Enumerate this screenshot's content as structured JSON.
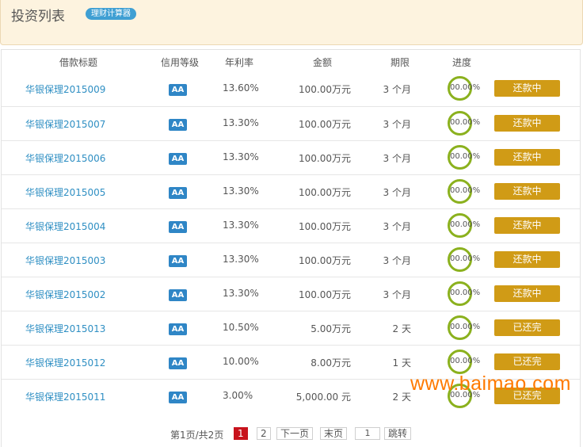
{
  "header": {
    "title": "投资列表",
    "calc_label": "理财计算器"
  },
  "columns": [
    "借款标题",
    "信用等级",
    "年利率",
    "金额",
    "期限",
    "进度"
  ],
  "rows": [
    {
      "title": "华银保理2015009",
      "grade": "AA",
      "rate": "13.60%",
      "amount": "100.00万元",
      "term": "3 个月",
      "progress": "00.00%",
      "status": "还款中"
    },
    {
      "title": "华银保理2015007",
      "grade": "AA",
      "rate": "13.30%",
      "amount": "100.00万元",
      "term": "3 个月",
      "progress": "00.00%",
      "status": "还款中"
    },
    {
      "title": "华银保理2015006",
      "grade": "AA",
      "rate": "13.30%",
      "amount": "100.00万元",
      "term": "3 个月",
      "progress": "00.00%",
      "status": "还款中"
    },
    {
      "title": "华银保理2015005",
      "grade": "AA",
      "rate": "13.30%",
      "amount": "100.00万元",
      "term": "3 个月",
      "progress": "00.00%",
      "status": "还款中"
    },
    {
      "title": "华银保理2015004",
      "grade": "AA",
      "rate": "13.30%",
      "amount": "100.00万元",
      "term": "3 个月",
      "progress": "00.00%",
      "status": "还款中"
    },
    {
      "title": "华银保理2015003",
      "grade": "AA",
      "rate": "13.30%",
      "amount": "100.00万元",
      "term": "3 个月",
      "progress": "00.00%",
      "status": "还款中"
    },
    {
      "title": "华银保理2015002",
      "grade": "AA",
      "rate": "13.30%",
      "amount": "100.00万元",
      "term": "3 个月",
      "progress": "00.00%",
      "status": "还款中"
    },
    {
      "title": "华银保理2015013",
      "grade": "AA",
      "rate": "10.50%",
      "amount": "5.00万元",
      "term": "2 天",
      "progress": "00.00%",
      "status": "已还完"
    },
    {
      "title": "华银保理2015012",
      "grade": "AA",
      "rate": "10.00%",
      "amount": "8.00万元",
      "term": "1 天",
      "progress": "00.00%",
      "status": "已还完"
    },
    {
      "title": "华银保理2015011",
      "grade": "AA",
      "rate": "3.00%",
      "amount": "5,000.00 元",
      "term": "2 天",
      "progress": "00.00%",
      "status": "已还完"
    }
  ],
  "pager": {
    "info": "第1页/共2页",
    "page1": "1",
    "page2": "2",
    "next": "下一页",
    "last": "末页",
    "jump_value": "1",
    "jump": "跳转"
  },
  "watermark": "www.baimao.com",
  "colors": {
    "accent_blue": "#2f8fc3",
    "status_gold": "#d09b16",
    "ring_green": "#8bb11e",
    "header_bg": "#fdf3df",
    "active_page_red": "#c8131c",
    "watermark_orange": "#ff7a00"
  }
}
